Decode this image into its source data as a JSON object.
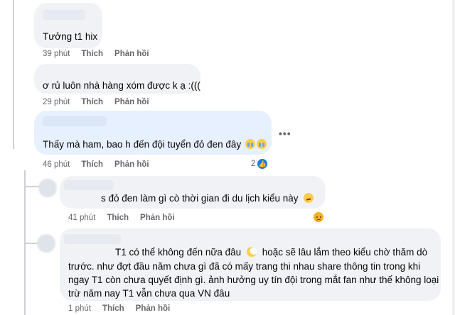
{
  "comments": [
    {
      "text": "Tưởng t1 hix",
      "time": "39 phút",
      "like_label": "Thích",
      "reply_label": "Phản hồi"
    },
    {
      "text": "ơ rủ luôn nhà hàng xóm được k ạ :(((",
      "time": "29 phút",
      "like_label": "Thích",
      "reply_label": "Phản hồi"
    },
    {
      "text": "Thấy mà ham, bao h đến đội tuyển đỏ đen đây",
      "time": "46 phút",
      "like_label": "Thích",
      "reply_label": "Phản hồi",
      "reaction_count": "2",
      "more_label": "•••"
    },
    {
      "text": "s đỏ đen làm gì cò thời gian đi du lịch kiểu này",
      "time": "41 phút",
      "like_label": "Thích",
      "reply_label": "Phản hồi"
    },
    {
      "lines": [
        "T1 có thể không đến nữa đâu",
        "hoặc sẽ lâu lắm theo kiểu chờ thăm dò",
        "trước. như đợt đầu năm chưa gì đã có mấy trang thi nhau share thông tin trong khi",
        "ngay T1 còn chưa quyết định gì. ảnh hưởng uy tín đội trong mắt fan như thế không loại",
        "trừ năm nay T1 vẫn chưa qua VN đâu"
      ],
      "time": "1 phút",
      "like_label": "Thích",
      "reply_label": "Phản hồi"
    }
  ],
  "icons": {
    "crying": "loudly-crying-face-icon",
    "confused": "confused-face-icon",
    "moon": "crescent-moon-icon",
    "sad_reaction": "sad-reaction-icon",
    "like": "like-reaction-icon"
  },
  "colors": {
    "bubble": "#f0f2f5",
    "bubble_selected": "#e7f0fe",
    "meta": "#65676b",
    "like_blue": "#1877f2"
  }
}
